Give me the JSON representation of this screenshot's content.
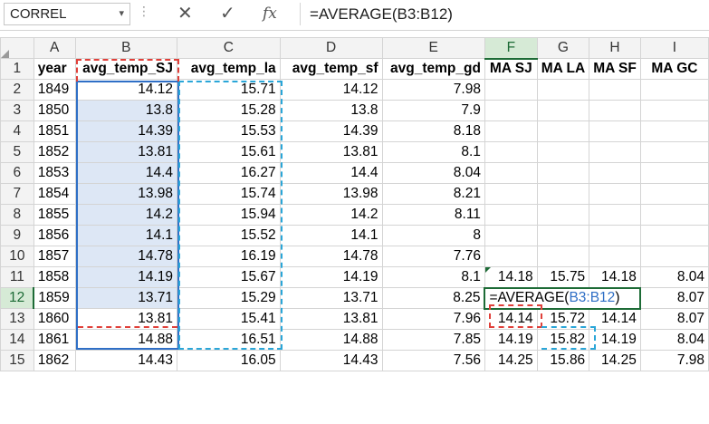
{
  "formula_bar": {
    "name_box": "CORREL",
    "formula": "=AVERAGE(B3:B12)"
  },
  "columns": [
    "A",
    "B",
    "C",
    "D",
    "E",
    "F",
    "G",
    "H",
    "I"
  ],
  "rows": [
    {
      "n": "1",
      "cells": [
        "year",
        "avg_temp_SJ",
        "avg_temp_la",
        "avg_temp_sf",
        "avg_temp_gd",
        "MA SJ",
        "MA LA",
        "MA SF",
        "MA GC"
      ]
    },
    {
      "n": "2",
      "cells": [
        "1849",
        "14.12",
        "15.71",
        "14.12",
        "7.98",
        "",
        "",
        "",
        ""
      ]
    },
    {
      "n": "3",
      "cells": [
        "1850",
        "13.8",
        "15.28",
        "13.8",
        "7.9",
        "",
        "",
        "",
        ""
      ]
    },
    {
      "n": "4",
      "cells": [
        "1851",
        "14.39",
        "15.53",
        "14.39",
        "8.18",
        "",
        "",
        "",
        ""
      ]
    },
    {
      "n": "5",
      "cells": [
        "1852",
        "13.81",
        "15.61",
        "13.81",
        "8.1",
        "",
        "",
        "",
        ""
      ]
    },
    {
      "n": "6",
      "cells": [
        "1853",
        "14.4",
        "16.27",
        "14.4",
        "8.04",
        "",
        "",
        "",
        ""
      ]
    },
    {
      "n": "7",
      "cells": [
        "1854",
        "13.98",
        "15.74",
        "13.98",
        "8.21",
        "",
        "",
        "",
        ""
      ]
    },
    {
      "n": "8",
      "cells": [
        "1855",
        "14.2",
        "15.94",
        "14.2",
        "8.11",
        "",
        "",
        "",
        ""
      ]
    },
    {
      "n": "9",
      "cells": [
        "1856",
        "14.1",
        "15.52",
        "14.1",
        "8",
        "",
        "",
        "",
        ""
      ]
    },
    {
      "n": "10",
      "cells": [
        "1857",
        "14.78",
        "16.19",
        "14.78",
        "7.76",
        "",
        "",
        "",
        ""
      ]
    },
    {
      "n": "11",
      "cells": [
        "1858",
        "14.19",
        "15.67",
        "14.19",
        "8.1",
        "14.18",
        "15.75",
        "14.18",
        "8.04"
      ]
    },
    {
      "n": "12",
      "cells": [
        "1859",
        "13.71",
        "15.29",
        "13.71",
        "8.25",
        "",
        "",
        "",
        "8.07"
      ]
    },
    {
      "n": "13",
      "cells": [
        "1860",
        "13.81",
        "15.41",
        "13.81",
        "7.96",
        "14.14",
        "15.72",
        "14.14",
        "8.07"
      ]
    },
    {
      "n": "14",
      "cells": [
        "1861",
        "14.88",
        "16.51",
        "14.88",
        "7.85",
        "14.19",
        "15.82",
        "14.19",
        "8.04"
      ]
    },
    {
      "n": "15",
      "cells": [
        "1862",
        "14.43",
        "16.05",
        "14.43",
        "7.56",
        "14.25",
        "15.86",
        "14.25",
        "7.98"
      ]
    }
  ],
  "editing_cell": {
    "prefix": "=AVERAGE(",
    "ref": "B3:B12",
    "suffix": ")"
  },
  "colors": {
    "accent": "#1d6b36",
    "ref_blue": "#2f6fc6",
    "ref_red": "#e0403a",
    "ref_cyan": "#2aa6d8"
  }
}
